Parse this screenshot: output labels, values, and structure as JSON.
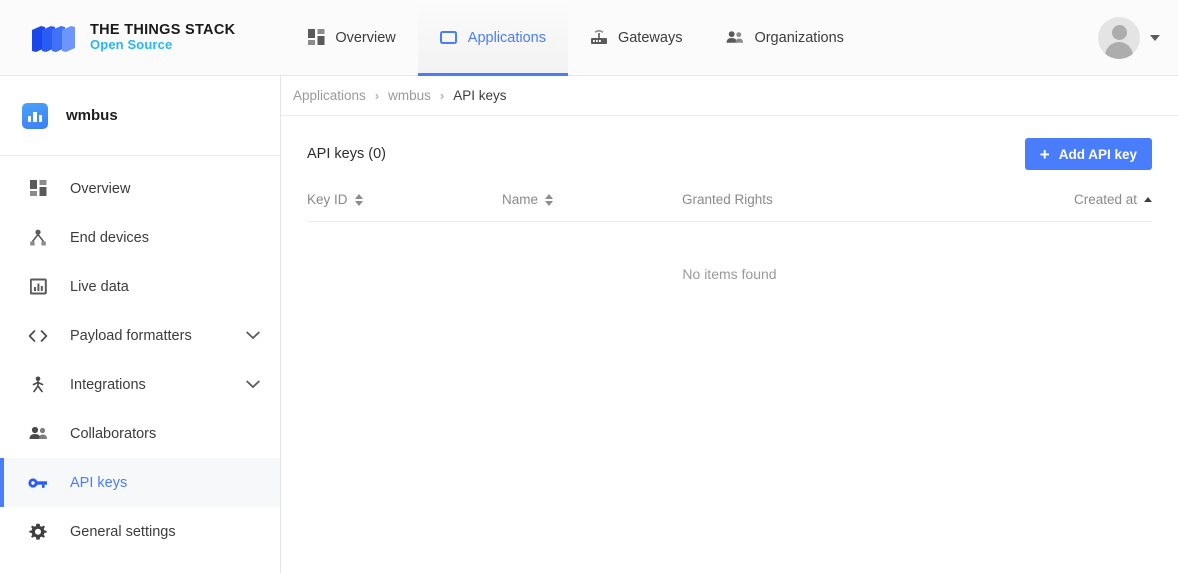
{
  "header": {
    "brand": {
      "logo_icon": "things-stack-logo-icon",
      "title": "THE THINGS STACK",
      "subtitle": "Open Source",
      "subtitle_color": "#29b6f6"
    },
    "nav": [
      {
        "label": "Overview",
        "icon": "grid-icon",
        "active": false
      },
      {
        "label": "Applications",
        "icon": "application-window-icon",
        "active": true
      },
      {
        "label": "Gateways",
        "icon": "gateway-router-icon",
        "active": false
      },
      {
        "label": "Organizations",
        "icon": "people-group-icon",
        "active": false
      }
    ],
    "user": {
      "avatar_icon": "user-avatar-icon",
      "dropdown_icon": "chevron-down-icon"
    },
    "accent_color": "#4a7dfc"
  },
  "sidebar": {
    "app": {
      "icon": "application-chart-icon",
      "name": "wmbus"
    },
    "items": [
      {
        "label": "Overview",
        "icon": "grid-icon",
        "active": false,
        "expandable": false
      },
      {
        "label": "End devices",
        "icon": "end-devices-node-icon",
        "active": false,
        "expandable": false
      },
      {
        "label": "Live data",
        "icon": "live-data-chart-icon",
        "active": false,
        "expandable": false
      },
      {
        "label": "Payload formatters",
        "icon": "code-brackets-icon",
        "active": false,
        "expandable": true
      },
      {
        "label": "Integrations",
        "icon": "integrations-person-icon",
        "active": false,
        "expandable": true
      },
      {
        "label": "Collaborators",
        "icon": "people-group-icon",
        "active": false,
        "expandable": false
      },
      {
        "label": "API keys",
        "icon": "key-icon",
        "active": true,
        "expandable": false
      },
      {
        "label": "General settings",
        "icon": "gear-icon",
        "active": false,
        "expandable": false
      }
    ]
  },
  "breadcrumb": {
    "separator": "›",
    "items": [
      {
        "label": "Applications",
        "current": false
      },
      {
        "label": "wmbus",
        "current": false
      },
      {
        "label": "API keys",
        "current": true
      }
    ]
  },
  "main": {
    "page_title": "API keys (0)",
    "add_button": {
      "label": "Add API key",
      "icon": "plus-icon",
      "color": "#4a7dfc"
    },
    "table": {
      "columns": [
        {
          "label": "Key ID",
          "sortable": true,
          "sort_state": "none"
        },
        {
          "label": "Name",
          "sortable": true,
          "sort_state": "none"
        },
        {
          "label": "Granted Rights",
          "sortable": false,
          "sort_state": "none"
        },
        {
          "label": "Created at",
          "sortable": true,
          "sort_state": "asc"
        }
      ],
      "rows": [],
      "empty_message": "No items found"
    }
  }
}
